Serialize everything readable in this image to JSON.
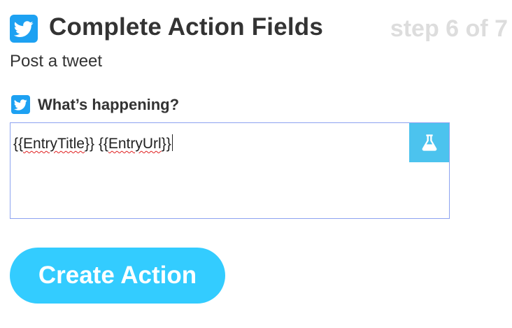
{
  "header": {
    "title": "Complete Action Fields",
    "step": "step 6 of 7",
    "service_icon": "twitter-bird-icon"
  },
  "subtitle": "Post a tweet",
  "field": {
    "label": "What’s happening?",
    "icon": "twitter-bird-icon",
    "value_parts": [
      "{{",
      "EntryTitle",
      "}} {{",
      "EntryUrl",
      "}}"
    ],
    "test_icon": "flask-icon"
  },
  "actions": {
    "create_label": "Create Action"
  },
  "colors": {
    "twitter_blue": "#1da1f2",
    "button_blue": "#33ccff",
    "flask_button": "#4cc3ee",
    "field_border": "#8da3f0",
    "step_gray": "#dddddd"
  }
}
